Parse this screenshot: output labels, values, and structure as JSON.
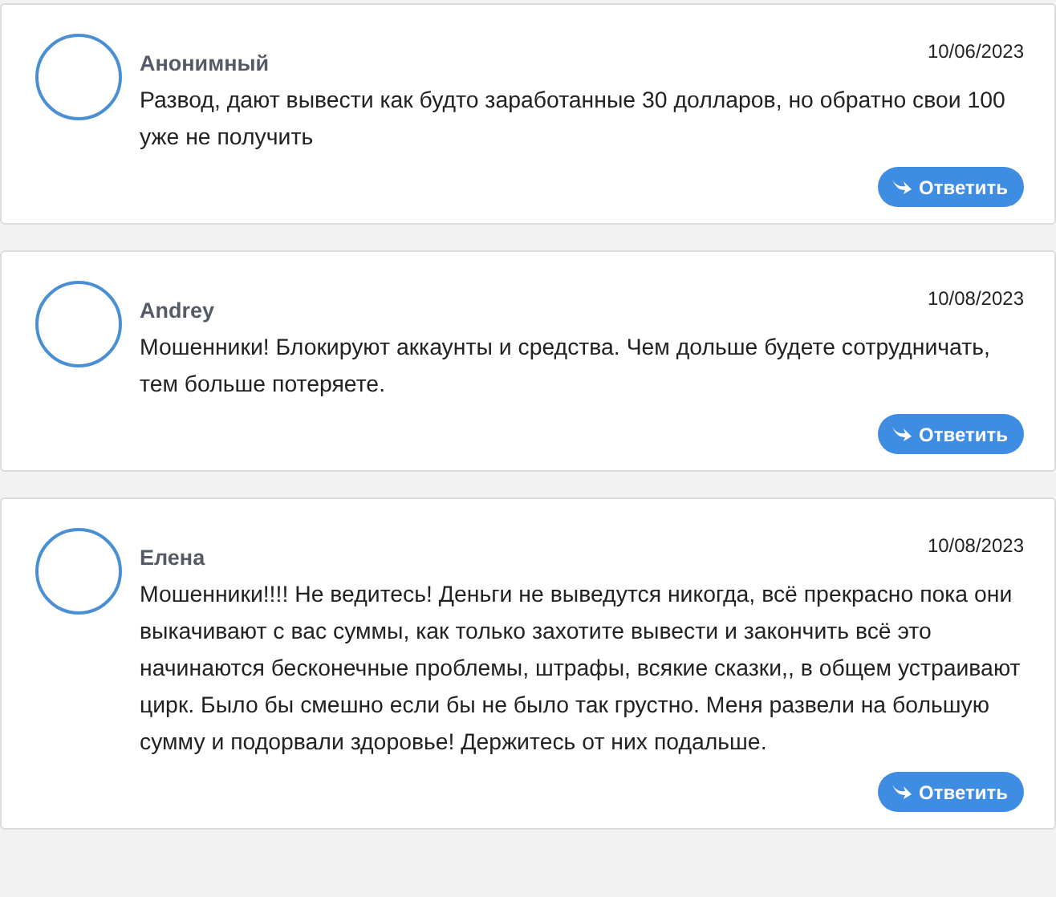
{
  "reviews": [
    {
      "author": "Анонимный",
      "date": "10/06/2023",
      "text": "Развод, дают вывести как будто заработанные 30 долларов, но обратно свои 100 уже не получить",
      "reply_button": "Ответить"
    },
    {
      "author": "Andrey",
      "date": "10/08/2023",
      "text": "Мошенники! Блокируют аккаунты и средства. Чем дольше будете сотрудничать, тем больше потеряете.",
      "reply_button": "Ответить"
    },
    {
      "author": "Елена",
      "date": "10/08/2023",
      "text": "Мошенники!!!! Не ведитесь! Деньги не выведутся никогда, всё прекрасно пока они выкачивают с вас суммы, как только захотите вывести и закончить всё это начинаются бесконечные проблемы, штрафы, всякие сказки,, в общем устраивают цирк. Было бы смешно если бы не было так грустно. Меня развели на большую сумму и подорвали здоровье! Держитесь от них подальше.",
      "reply_button": "Ответить"
    }
  ]
}
